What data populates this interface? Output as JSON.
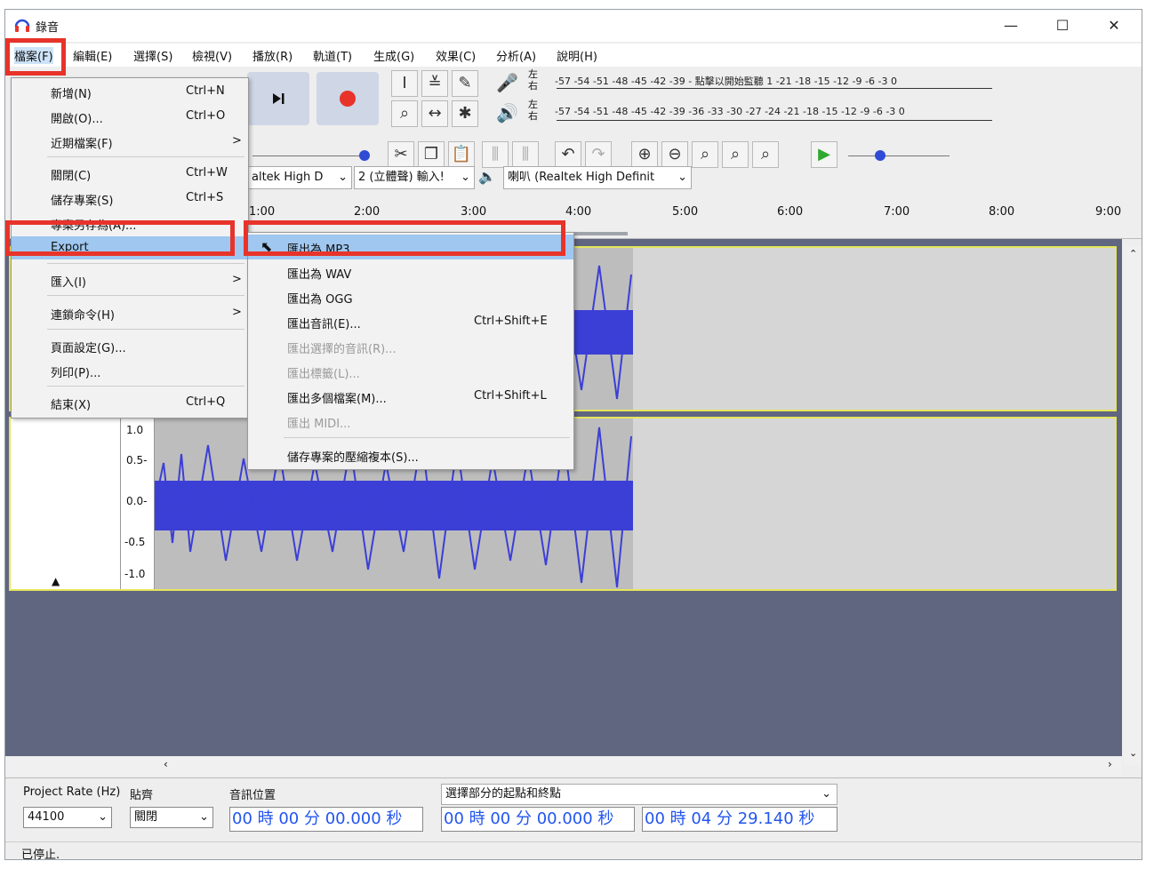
{
  "window": {
    "title": "錄音",
    "controls": {
      "minimize": "—",
      "maximize": "☐",
      "close": "✕"
    }
  },
  "menubar": {
    "items": [
      "檔案(F)",
      "編輯(E)",
      "選擇(S)",
      "檢視(V)",
      "播放(R)",
      "軌道(T)",
      "生成(G)",
      "效果(C)",
      "分析(A)",
      "說明(H)"
    ]
  },
  "toolbar": {
    "meters": {
      "record_label_top": "左",
      "record_label_bottom": "右",
      "play_label_top": "左",
      "play_label_bottom": "右",
      "record_scale": "-57 -54 -51 -48 -45 -42 -39 - 點擊以開始監聽 1 -21 -18 -15 -12 -9 -6 -3 0",
      "play_scale": "-57 -54 -51 -48 -45 -42 -39 -36 -33 -30 -27 -24 -21 -18 -15 -12 -9 -6 -3 0"
    },
    "devices": {
      "input_device": "altek High D",
      "channels": "2 (立體聲) 輸入!",
      "output_device": "喇叭 (Realtek High Definit"
    }
  },
  "timeline": {
    "ticks": [
      "1:00",
      "2:00",
      "3:00",
      "4:00",
      "5:00",
      "6:00",
      "7:00",
      "8:00",
      "9:00"
    ]
  },
  "track": {
    "scale": [
      "1.0",
      "0.5-",
      "0.0-",
      "-0.5",
      "-1.0"
    ]
  },
  "file_menu": {
    "items": [
      {
        "label": "新增(N)",
        "shortcut": "Ctrl+N"
      },
      {
        "label": "開啟(O)...",
        "shortcut": "Ctrl+O"
      },
      {
        "label": "近期檔案(F)",
        "shortcut": "",
        "arrow": ">"
      },
      {
        "label": "關閉(C)",
        "shortcut": "Ctrl+W"
      },
      {
        "label": "儲存專案(S)",
        "shortcut": "Ctrl+S"
      },
      {
        "label": "專案另存為(A)...",
        "shortcut": ""
      },
      {
        "label": "Export",
        "shortcut": ""
      },
      {
        "label": "匯入(I)",
        "shortcut": "",
        "arrow": ">"
      },
      {
        "label": "連鎖命令(H)",
        "shortcut": "",
        "arrow": ">"
      },
      {
        "label": "頁面設定(G)...",
        "shortcut": ""
      },
      {
        "label": "列印(P)...",
        "shortcut": ""
      },
      {
        "label": "結束(X)",
        "shortcut": "Ctrl+Q"
      }
    ]
  },
  "export_menu": {
    "items": [
      {
        "label": "匯出為 MP3",
        "shortcut": ""
      },
      {
        "label": "匯出為 WAV",
        "shortcut": ""
      },
      {
        "label": "匯出為 OGG",
        "shortcut": ""
      },
      {
        "label": "匯出音訊(E)...",
        "shortcut": "Ctrl+Shift+E"
      },
      {
        "label": "匯出選擇的音訊(R)...",
        "shortcut": ""
      },
      {
        "label": "匯出標籤(L)...",
        "shortcut": ""
      },
      {
        "label": "匯出多個檔案(M)...",
        "shortcut": "Ctrl+Shift+L"
      },
      {
        "label": "匯出 MIDI...",
        "shortcut": ""
      },
      {
        "label": "儲存專案的壓縮複本(S)...",
        "shortcut": ""
      }
    ]
  },
  "selection_toolbar": {
    "project_rate_label": "Project Rate (Hz)",
    "project_rate_value": "44100",
    "snap_label": "貼齊",
    "snap_value": "關閉",
    "audio_position_label": "音訊位置",
    "audio_position_value": "00 時 00 分 00.000 秒",
    "selection_mode": "選擇部分的起點和終點",
    "selection_start": "00 時 00 分 00.000 秒",
    "selection_end": "00 時 04 分 29.140 秒"
  },
  "status": {
    "text": "已停止."
  },
  "colors": {
    "highlight": "#9fc7f0",
    "callout_red": "#e8332a",
    "waveform_blue": "#3b3fd6",
    "time_digits": "#2255ee",
    "track_border": "#e5e55c",
    "track_bg_dark": "#606580"
  }
}
